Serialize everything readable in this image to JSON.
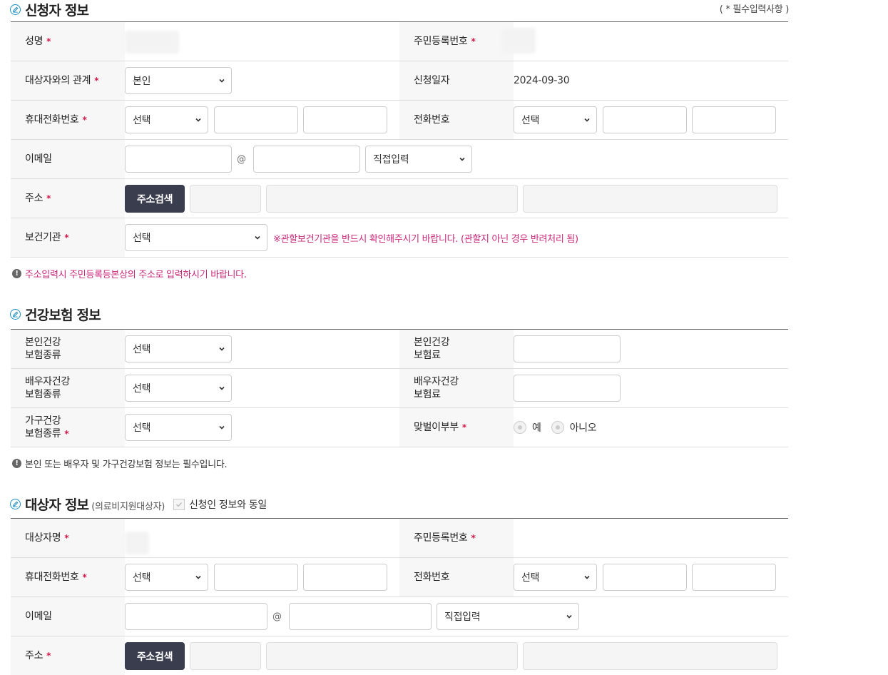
{
  "applicant": {
    "title": "신청자 정보",
    "required_note": "( * 필수입력사항 )",
    "name_label": "성명",
    "rrn_label": "주민등록번호",
    "relation_label": "대상자와의 관계",
    "relation_value": "본인",
    "apply_date_label": "신청일자",
    "apply_date_value": "2024-09-30",
    "mobile_label": "휴대전화번호",
    "mobile_select": "선택",
    "phone_label": "전화번호",
    "phone_select": "선택",
    "email_label": "이메일",
    "email_at": "@",
    "email_domain_select": "직접입력",
    "address_label": "주소",
    "address_button": "주소검색",
    "health_center_label": "보건기관",
    "health_center_select": "선택",
    "health_center_warning": "※관할보건기관을 반드시 확인해주시기 바랍니다. (관할지 아닌 경우 반려처리 됨)",
    "address_note": "주소입력시 주민등록등본상의 주소로 입력하시기 바랍니다."
  },
  "insurance": {
    "title": "건강보험 정보",
    "self_type_label_1": "본인건강",
    "self_type_label_2": "보험종류",
    "self_type_select": "선택",
    "self_fee_label_1": "본인건강",
    "self_fee_label_2": "보험료",
    "spouse_type_label_1": "배우자건강",
    "spouse_type_label_2": "보험종류",
    "spouse_type_select": "선택",
    "spouse_fee_label_1": "배우자건강",
    "spouse_fee_label_2": "보험료",
    "household_type_label_1": "가구건강",
    "household_type_label_2": "보험종류",
    "household_type_select": "선택",
    "dual_income_label": "맞벌이부부",
    "radio_yes": "예",
    "radio_no": "아니오",
    "note": "본인 또는 배우자 및 가구건강보험 정보는 필수입니다."
  },
  "subject": {
    "title": "대상자 정보",
    "subtitle": "(의료비지원대상자)",
    "same_as_applicant": "신청인 정보와 동일",
    "name_label": "대상자명",
    "rrn_label": "주민등록번호",
    "mobile_label": "휴대전화번호",
    "mobile_select": "선택",
    "phone_label": "전화번호",
    "phone_select": "선택",
    "email_label": "이메일",
    "email_at": "@",
    "email_domain_select": "직접입력",
    "address_label": "주소",
    "address_button": "주소검색"
  }
}
